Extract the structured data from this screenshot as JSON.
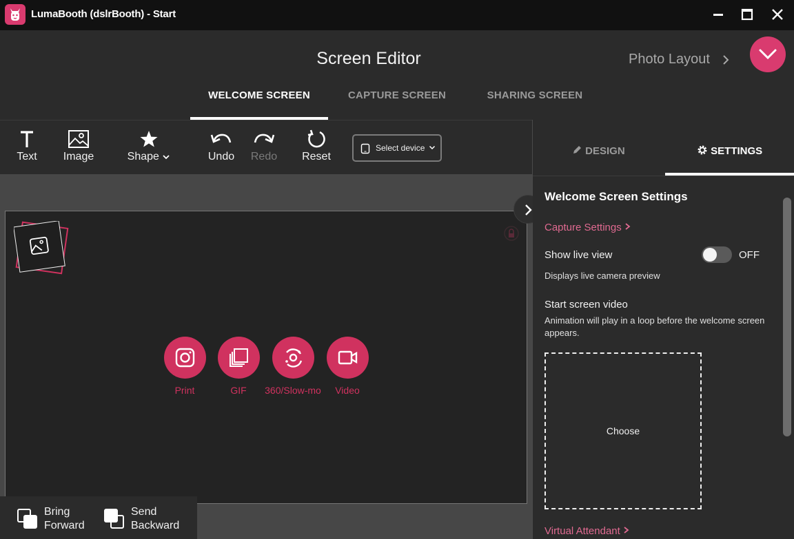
{
  "window": {
    "title": "LumaBooth (dslrBooth) - Start"
  },
  "header": {
    "title": "Screen Editor",
    "next_link": "Photo Layout",
    "tabs": [
      {
        "label": "WELCOME SCREEN",
        "active": true
      },
      {
        "label": "CAPTURE SCREEN",
        "active": false
      },
      {
        "label": "SHARING SCREEN",
        "active": false
      }
    ]
  },
  "toolbar": {
    "text": "Text",
    "image": "Image",
    "shape": "Shape",
    "undo": "Undo",
    "redo": "Redo",
    "reset": "Reset",
    "device_select": "Select device"
  },
  "canvas": {
    "actions": [
      {
        "label": "Print",
        "icon": "instagram-icon"
      },
      {
        "label": "GIF",
        "icon": "gif-stack-icon"
      },
      {
        "label": "360/Slow-mo",
        "icon": "orbit-icon"
      },
      {
        "label": "Video",
        "icon": "video-camera-icon"
      }
    ]
  },
  "arrange": {
    "bring_forward": [
      "Bring",
      "Forward"
    ],
    "send_backward": [
      "Send",
      "Backward"
    ]
  },
  "right_panel": {
    "tabs": {
      "design": "DESIGN",
      "settings": "SETTINGS"
    },
    "heading": "Welcome Screen Settings",
    "capture_settings_link": "Capture Settings",
    "live_view": {
      "label": "Show live view",
      "state": "OFF",
      "description": "Displays live camera preview"
    },
    "start_video": {
      "label": "Start screen video",
      "description": "Animation will play in a loop before the welcome screen appears."
    },
    "choose_label": "Choose",
    "virtual_attendant_link": "Virtual Attendant"
  },
  "colors": {
    "accent": "#d0325f",
    "link": "#e06a91",
    "titlebar": "#111111",
    "panel": "#2b2b2b",
    "canvas": "#232323"
  }
}
